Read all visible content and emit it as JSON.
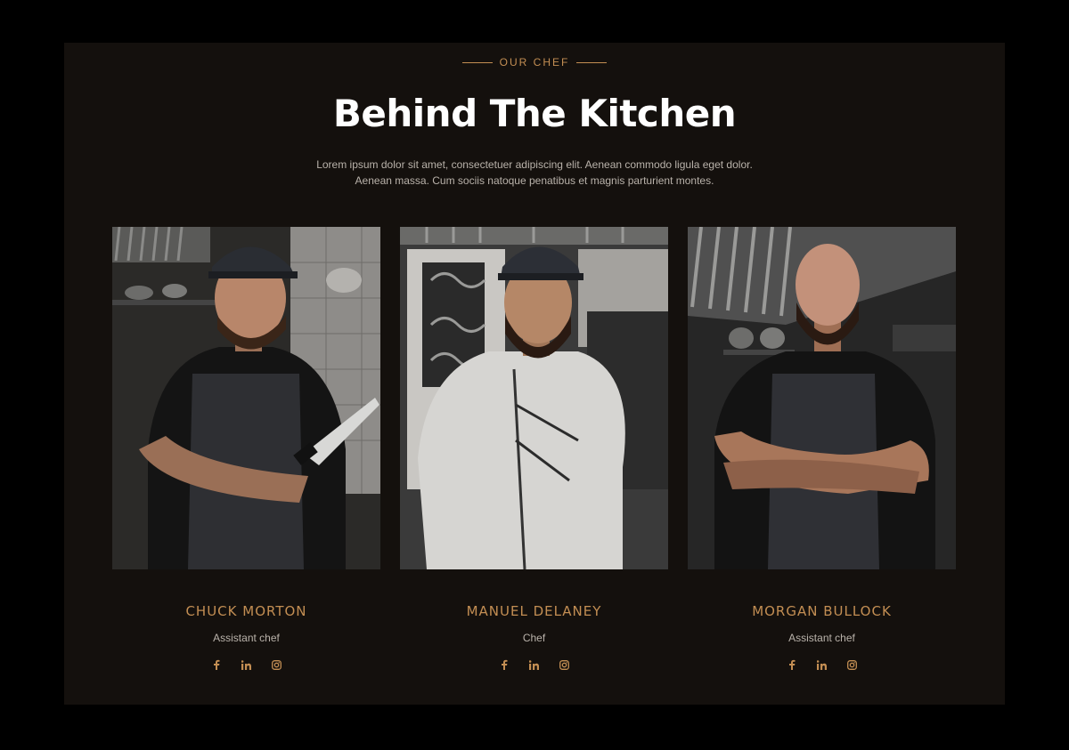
{
  "header": {
    "eyebrow": "OUR CHEF",
    "title": "Behind The Kitchen",
    "description": "Lorem ipsum dolor sit amet, consectetuer adipiscing elit. Aenean commodo ligula eget dolor. Aenean massa. Cum sociis natoque penatibus et magnis parturient montes."
  },
  "chefs": [
    {
      "name": "CHUCK MORTON",
      "role": "Assistant chef",
      "photo": "chef-with-knife-photo"
    },
    {
      "name": "MANUEL DELANEY",
      "role": "Chef",
      "photo": "chef-in-white-jacket-photo"
    },
    {
      "name": "MORGAN BULLOCK",
      "role": "Assistant chef",
      "photo": "chef-arms-crossed-photo"
    }
  ],
  "social_icons": [
    "facebook-icon",
    "linkedin-icon",
    "instagram-icon"
  ],
  "colors": {
    "accent": "#c38e53",
    "background": "#14100d",
    "page": "#000000",
    "title": "#ffffff",
    "body_text": "#b9b2aa"
  }
}
